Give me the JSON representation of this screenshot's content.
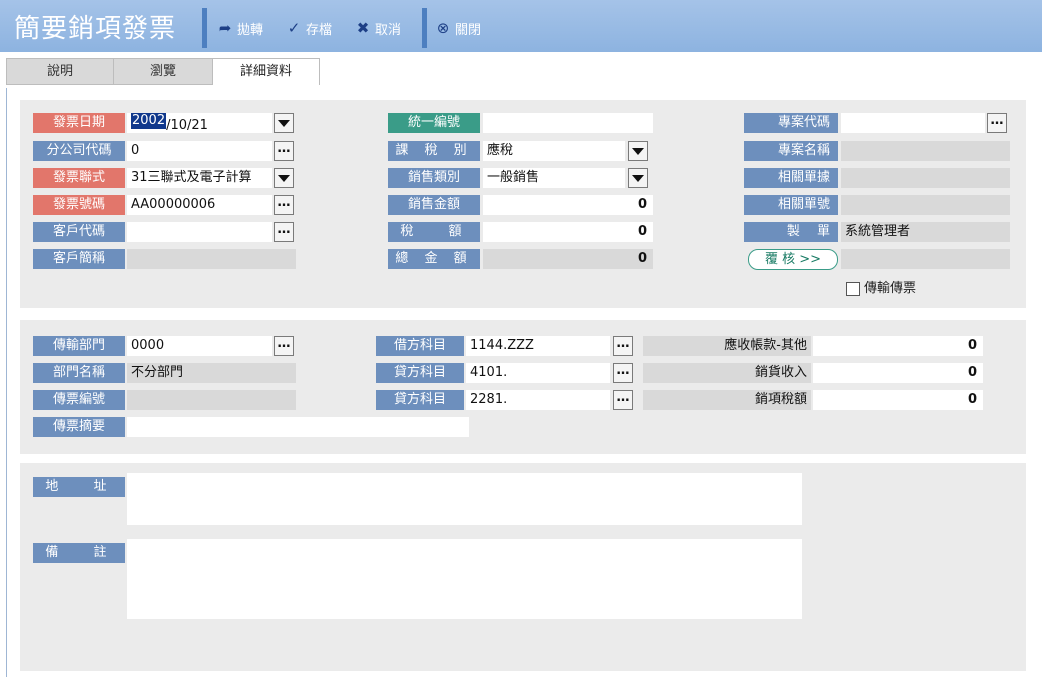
{
  "app": {
    "title": "簡要銷項發票"
  },
  "toolbar": {
    "transfer": "拋轉",
    "save": "存檔",
    "cancel": "取消",
    "close": "關閉"
  },
  "tabs": [
    {
      "label": "說明"
    },
    {
      "label": "瀏覽"
    },
    {
      "label": "詳細資料"
    }
  ],
  "invoice": {
    "date_label": "發票日期",
    "date_selected": "2002",
    "date_rest": "/10/21",
    "branch_label": "分公司代碼",
    "branch_value": "0",
    "type_label": "發票聯式",
    "type_value": "31三聯式及電子計算",
    "number_label": "發票號碼",
    "number_value": "AA00000006",
    "customer_code_label": "客戶代碼",
    "customer_code_value": "",
    "customer_short_label": "客戶簡稱",
    "customer_short_value": "",
    "tax_id_label": "統一編號",
    "tax_id_value": "",
    "tax_type_label": "課 稅 別",
    "tax_type_value": "應稅",
    "sales_type_label": "銷售類別",
    "sales_type_value": "一般銷售",
    "sales_amount_label": "銷售金額",
    "sales_amount_value": "0",
    "tax_label": "稅　 額",
    "tax_value": "0",
    "total_label": "總 金 額",
    "total_value": "0",
    "project_code_label": "專案代碼",
    "project_code_value": "",
    "project_name_label": "專案名稱",
    "project_name_value": "",
    "related_doc1_label": "相關單據",
    "related_doc1_value": "",
    "related_doc2_label": "相關單號",
    "related_doc2_value": "",
    "maker_label": "製　 單",
    "maker_value": "系統管理者",
    "review_button": "覆 核 >>",
    "review_value": "",
    "transfer_voucher_label": "傳輸傳票"
  },
  "voucher": {
    "dept_label": "傳輸部門",
    "dept_value": "0000",
    "dept_name_label": "部門名稱",
    "dept_name_value": "不分部門",
    "voucher_no_label": "傳票編號",
    "voucher_no_value": "",
    "summary_label": "傳票摘要",
    "summary_value": "",
    "debit_label": "借方科目",
    "debit_value": "1144.ZZZ",
    "debit_name": "應收帳款-其他",
    "debit_amount": "0",
    "credit1_label": "貸方科目",
    "credit1_value": "4101.",
    "credit1_name": "銷貨收入",
    "credit1_amount": "0",
    "credit2_label": "貸方科目",
    "credit2_value": "2281.",
    "credit2_name": "銷項稅額",
    "credit2_amount": "0"
  },
  "notes": {
    "address_label": "地　 址",
    "address_value": "",
    "remark_label": "備　 註",
    "remark_value": ""
  },
  "colors": {
    "title_bar": "#8db3e0",
    "label_blue": "#6d8fbd",
    "label_red": "#e2766b",
    "label_teal": "#3a9c88",
    "panel": "#ebebeb"
  }
}
